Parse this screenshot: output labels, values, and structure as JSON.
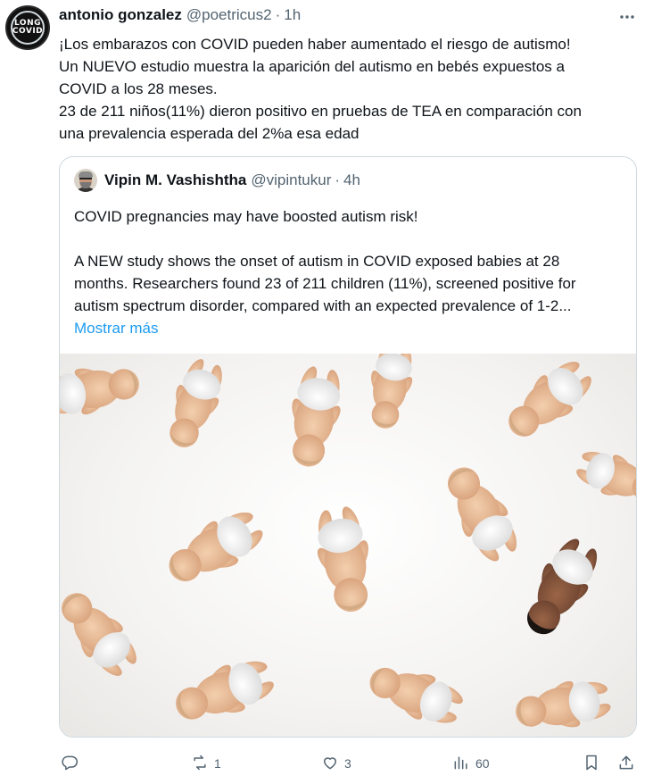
{
  "tweet": {
    "avatar": {
      "line1": "LONG",
      "line2": "COVID",
      "line3": "LONG COVID"
    },
    "display_name": "antonio gonzalez",
    "handle": "@poetricus2",
    "separator": "·",
    "time": "1h",
    "text_lines": [
      "¡Los embarazos con COVID pueden haber aumentado el riesgo de autismo!",
      "Un NUEVO estudio muestra la aparición del autismo en bebés expuestos a",
      "COVID a los 28 meses.",
      "23 de 211 niños(11%) dieron positivo en pruebas de TEA en comparación con",
      "una prevalencia esperada del 2%a esa edad"
    ]
  },
  "quote": {
    "display_name": "Vipin M. Vashishtha",
    "handle": "@vipintukur",
    "separator": "·",
    "time": "4h",
    "text_first": "COVID pregnancies may have boosted autism risk!",
    "text_lines": [
      "A NEW study shows the onset of autism in COVID exposed babies at 28",
      "months. Researchers found 23 of 211 children (11%), screened positive for",
      "autism spectrum disorder, compared with an expected prevalence of 1-2..."
    ],
    "show_more": "Mostrar más"
  },
  "actions": {
    "reply": {
      "icon": "reply-icon",
      "count": ""
    },
    "retweet": {
      "icon": "retweet-icon",
      "count": "1"
    },
    "like": {
      "icon": "heart-icon",
      "count": "3"
    },
    "views": {
      "icon": "views-icon",
      "count": "60"
    },
    "bookmark": {
      "icon": "bookmark-icon"
    },
    "share": {
      "icon": "share-icon"
    }
  },
  "colors": {
    "text": "#0f1419",
    "secondary": "#536471",
    "link": "#1d9bf0",
    "border": "#cfd9de"
  }
}
